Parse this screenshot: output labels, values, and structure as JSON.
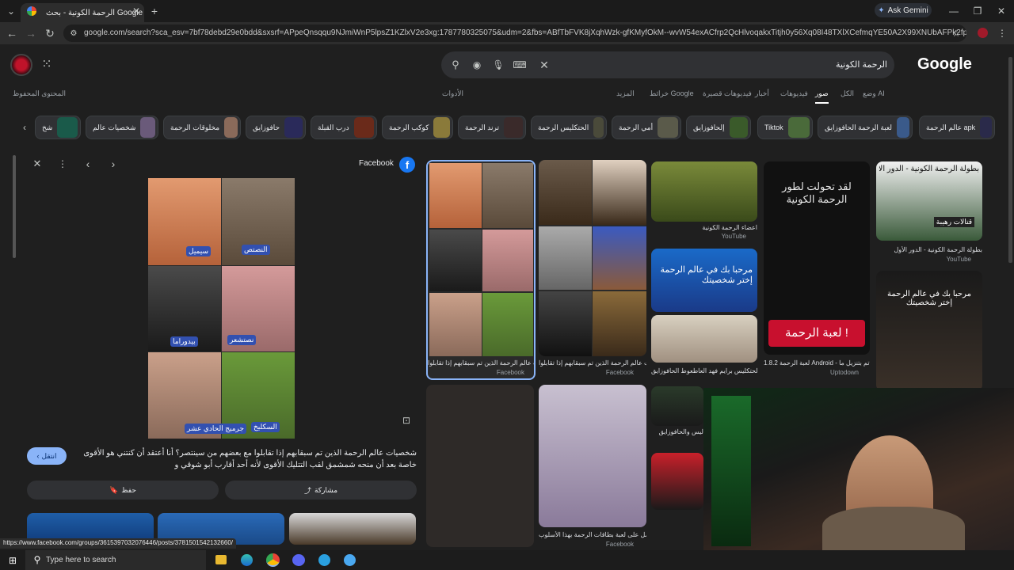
{
  "browser": {
    "tab_title": "الرحمة الكونية - بحث Google",
    "new_tab": "+",
    "ask_gemini": "Ask Gemini",
    "url": "google.com/search?sca_esv=7bf78debd29e0bdd&sxsrf=APpeQnsqqu9NJmiWnP5lpsZ1KZlxV2e3xg:1787780325075&udm=2&fbs=ABfTbFVK8jXqhWzk-gfKMyfOkM--wvW54exACfrp2QcHlvoqakxTitjh0y56Xq08I48TXlXCefmqYE50A2X99XNUbAFPk2fpfoxb0tn6WZxT..."
  },
  "google": {
    "logo": "Google",
    "query": "الرحمة الكونية",
    "nav_tabs": [
      "وضع AI",
      "الكل",
      "صور",
      "فيديوهات",
      "أخبار",
      "فيديوهات قصيرة",
      "خرائط Google",
      "المزيد"
    ],
    "tools": "الأدوات",
    "saved": "المحتوى المحفوظ",
    "chips": [
      "عالم الرحمة apk",
      "لعبة الرحمة الحافوزايق",
      "Tiktok",
      "إلحافوزايق",
      "أمي الرحمة",
      "الحتكليس الرحمة",
      "ترند الرحمة",
      "كوكب الرحمة",
      "درب القبلة",
      "حافوزايق",
      "مخلوقات الرحمة",
      "شخصيات عالم",
      "شخ"
    ]
  },
  "results": [
    {
      "caption": "شخصيات عالم الرحمة الذين تم سبقابهم إذا تقابلوا...",
      "source": "Facebook"
    },
    {
      "caption": "شخصيات عالم الرحمة الذين تم سبقابهم إذا تقابلوا...",
      "source": "Facebook"
    },
    {
      "caption": "اعضاء الرحمة الكونية",
      "source": "YouTube"
    },
    {
      "caption": "بطولة الرحمة الكونية - الدور الأول",
      "source": "YouTube"
    },
    {
      "caption": "لعبة الرحمة 1.8.2 Android - تم بتنزيل ما...",
      "source": "Uptodown"
    },
    {
      "caption": "لحتكليس برايم فهد العاطعوط الحافوزايق",
      "source": ""
    },
    {
      "caption": "لو تحصل على لعبة بطاقات الرحمة بهذا الأسلوب",
      "source": "Facebook"
    },
    {
      "caption": "ليس والحافوزايق",
      "source": ""
    }
  ],
  "preview": {
    "source": "Facebook",
    "labels": [
      "سيميل",
      "النصتص",
      "بيدوراما",
      "نصتشعر",
      "جرميج الحادي عشر",
      "السكليخ"
    ],
    "visit": "انتقل",
    "description": "شخصيات عالم الرحمة الذين تم سبقابهم إذا تقابلوا مع بعضهم من سينتصر؟ أنا أعتقد أن كنتني هو الأقوى خاصة بعد أن منحه شمشمق لقب التتليك الأقوى لأنه أحد أقارب أبو شوقي و",
    "share": "مشاركة",
    "save": "حفظ"
  },
  "card_texts": {
    "poster_title": "لقد تحولت لطور الرحمة الكونية",
    "poster_footer": "لعبة الرحمة !",
    "welcome": "مرحبا بك في عالم الرحمة إختر شخصيتك",
    "tournament": "بطولة الرحمة الكونية - الدور الأول",
    "khafi": "قتالات رهيبة"
  },
  "status_url": "https://www.facebook.com/groups/3615397032076446/posts/3781501542132660/",
  "taskbar": {
    "search": "Type here to search"
  }
}
